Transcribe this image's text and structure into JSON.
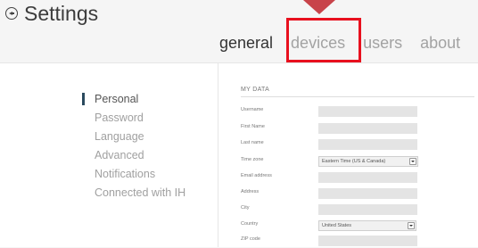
{
  "header": {
    "title": "Settings",
    "back_icon": "back-circle-icon"
  },
  "tabs": [
    {
      "label": "general",
      "active": true
    },
    {
      "label": "devices",
      "active": false,
      "highlighted": true
    },
    {
      "label": "users",
      "active": false
    },
    {
      "label": "about",
      "active": false
    }
  ],
  "sidebar": {
    "items": [
      {
        "label": "Personal",
        "active": true
      },
      {
        "label": "Password",
        "active": false
      },
      {
        "label": "Language",
        "active": false
      },
      {
        "label": "Advanced",
        "active": false
      },
      {
        "label": "Notifications",
        "active": false
      },
      {
        "label": "Connected with IH",
        "active": false
      }
    ]
  },
  "form": {
    "section_title": "MY DATA",
    "fields": [
      {
        "label": "Username",
        "value": ""
      },
      {
        "label": "First Name",
        "value": ""
      },
      {
        "label": "Last name",
        "value": ""
      },
      {
        "label": "Time zone",
        "value": "Eastern Time (US & Canada)"
      },
      {
        "label": "Email address",
        "value": ""
      },
      {
        "label": "Address",
        "value": ""
      },
      {
        "label": "City",
        "value": ""
      },
      {
        "label": "Country",
        "value": "United States"
      },
      {
        "label": "ZIP code",
        "value": ""
      }
    ]
  },
  "colors": {
    "highlight": "#e8101e",
    "pointer": "#c8434a",
    "active_marker": "#2a4a5e"
  }
}
